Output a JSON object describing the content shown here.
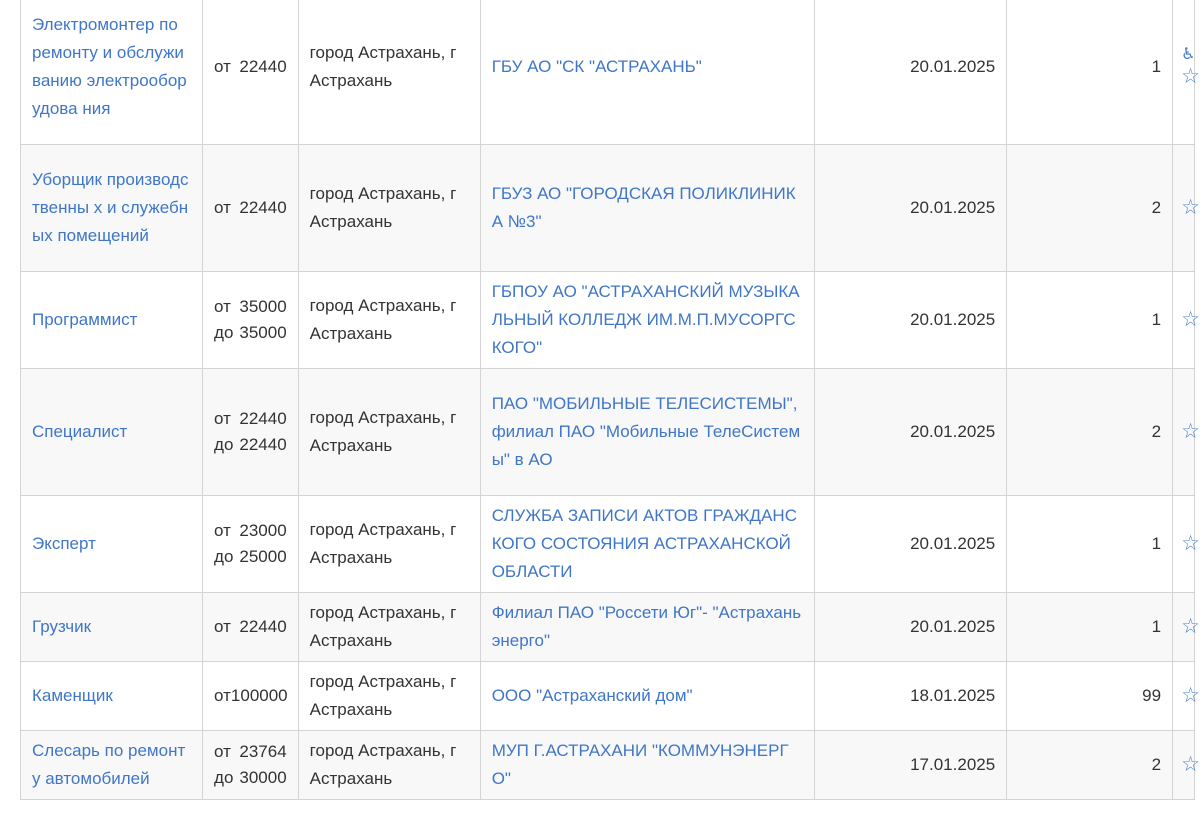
{
  "vacancies": [
    {
      "title": "Электромонтер по ремонту и обслуживанию электрооборудова ния",
      "salary_from_label": "от",
      "salary_from": "22440",
      "location": "город Астрахань, г Астрахань",
      "employer": "ГБУ АО \"СК \"АСТРАХАНЬ\"",
      "date": "20.01.2025",
      "count": "1",
      "accessible": true,
      "star_icon": "☆",
      "accessible_icon": "♿"
    },
    {
      "title": "Уборщик производственны х и служебных помещений",
      "salary_from_label": "от",
      "salary_from": "22440",
      "location": "город Астрахань, г Астрахань",
      "employer": "ГБУЗ АО \"ГОРОДСКАЯ ПОЛИКЛИНИКА №3\"",
      "date": "20.01.2025",
      "count": "2",
      "star_icon": "☆"
    },
    {
      "title": "Программист",
      "salary_from_label": "от",
      "salary_from": "35000",
      "salary_to_label": "до",
      "salary_to": "35000",
      "location": "город Астрахань, г Астрахань",
      "employer": "ГБПОУ АО \"АСТРАХАНСКИЙ МУЗЫКАЛЬНЫЙ КОЛЛЕДЖ ИМ.М.П.МУСОРГСКОГО\"",
      "date": "20.01.2025",
      "count": "1",
      "star_icon": "☆"
    },
    {
      "title": "Специалист",
      "salary_from_label": "от",
      "salary_from": "22440",
      "salary_to_label": "до",
      "salary_to": "22440",
      "location": "город Астрахань, г Астрахань",
      "employer": "ПАО \"МОБИЛЬНЫЕ ТЕЛЕСИСТЕМЫ\",филиал ПАО \"Мобильные ТелеСистемы\" в АО",
      "date": "20.01.2025",
      "count": "2",
      "star_icon": "☆"
    },
    {
      "title": "Эксперт",
      "salary_from_label": "от",
      "salary_from": "23000",
      "salary_to_label": "до",
      "salary_to": "25000",
      "location": "город Астрахань, г Астрахань",
      "employer": "СЛУЖБА ЗАПИСИ АКТОВ ГРАЖДАНСКОГО СОСТОЯНИЯ АСТРАХАНСКОЙ ОБЛАСТИ",
      "date": "20.01.2025",
      "count": "1",
      "star_icon": "☆"
    },
    {
      "title": "Грузчик",
      "salary_from_label": "от",
      "salary_from": "22440",
      "location": "город Астрахань, г Астрахань",
      "employer": "Филиал ПАО \"Россети Юг\"- \"Астраханьэнерго\"",
      "date": "20.01.2025",
      "count": "1",
      "star_icon": "☆"
    },
    {
      "title": "Каменщик",
      "salary_from_label": "от",
      "salary_from": "100000",
      "location": "город Астрахань, г Астрахань",
      "employer": "ООО \"Астраханский дом\"",
      "date": "18.01.2025",
      "count": "99",
      "star_icon": "☆"
    },
    {
      "title": "Слесарь по ремонту автомобилей",
      "salary_from_label": "от",
      "salary_from": "23764",
      "salary_to_label": "до",
      "salary_to": "30000",
      "location": "город Астрахань, г Астрахань",
      "employer": "МУП Г.АСТРАХАНИ \"КОММУНЭНЕРГО\"",
      "date": "17.01.2025",
      "count": "2",
      "star_icon": "☆"
    }
  ],
  "colors": {
    "link": "#3f76c8",
    "border": "#d4d4d4",
    "row_alt": "#f8f8f8",
    "text": "#333333"
  }
}
